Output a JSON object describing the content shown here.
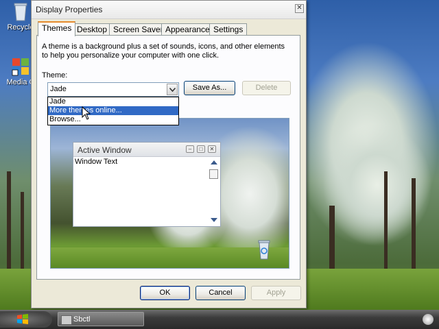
{
  "desktop": {
    "icons": [
      {
        "label": "Recycle",
        "icon": "recycle-bin-icon"
      },
      {
        "label": "Media C",
        "icon": "media-center-icon"
      }
    ]
  },
  "taskbar": {
    "task_label": "Sbctl",
    "start_icon": "windows-flag-icon",
    "tray_icon": "tray-icon"
  },
  "window": {
    "title": "Display Properties",
    "close_glyph": "✕",
    "tabs": [
      {
        "label": "Themes",
        "active": true
      },
      {
        "label": "Desktop",
        "active": false
      },
      {
        "label": "Screen Saver",
        "active": false
      },
      {
        "label": "Appearance",
        "active": false
      },
      {
        "label": "Settings",
        "active": false
      }
    ],
    "description": "A theme is a background plus a set of sounds, icons, and other elements to help you personalize your computer with one click.",
    "theme_label": "Theme:",
    "theme_value": "Jade",
    "save_as_label": "Save As...",
    "delete_label": "Delete",
    "dropdown_items": [
      "Jade",
      "More themes online...",
      "Browse..."
    ],
    "dropdown_highlighted": "More themes online...",
    "preview": {
      "window_title": "Active Window",
      "window_text": "Window Text"
    },
    "ok_label": "OK",
    "cancel_label": "Cancel",
    "apply_label": "Apply"
  },
  "colors": {
    "accent": "#316ac5",
    "tab_highlight": "#e68b2c",
    "disabled_text": "#a1a192"
  }
}
